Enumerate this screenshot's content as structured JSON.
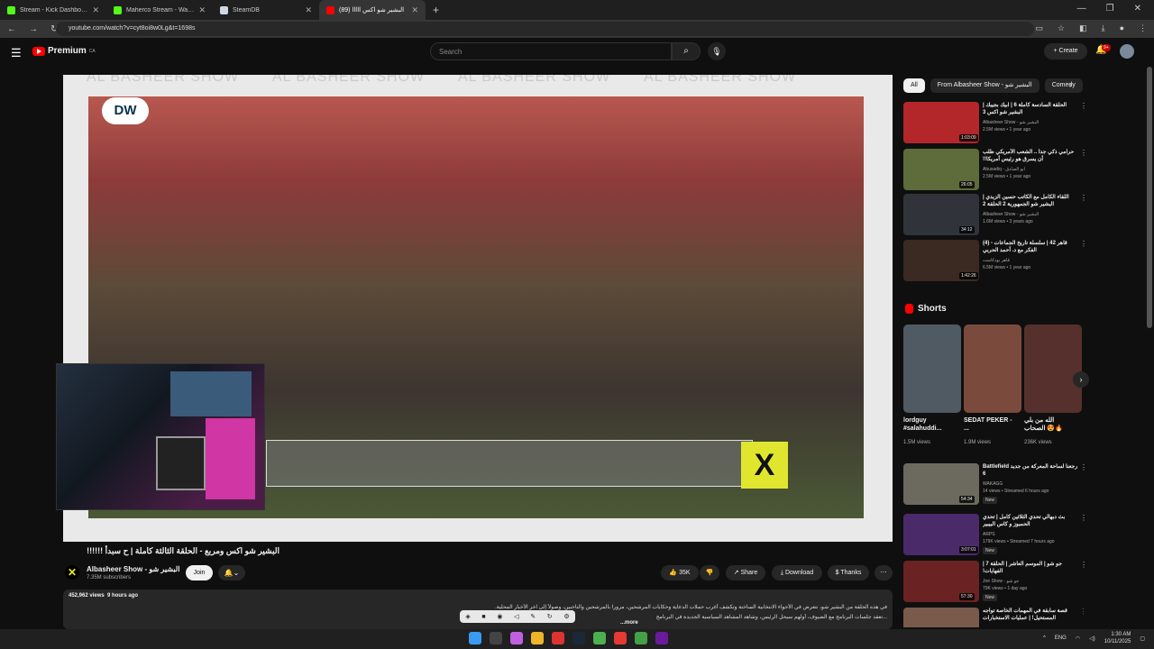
{
  "browser": {
    "tabs": [
      {
        "label": "Stream - Kick Dashboard",
        "color": "#53fc18",
        "active": false
      },
      {
        "label": "Maherco Stream - Watch Live o",
        "color": "#53fc18",
        "active": false
      },
      {
        "label": "SteamDB",
        "color": "#cfd8e0",
        "active": false
      },
      {
        "label": "(89) البشير شو اكس ااااا",
        "color": "#ff0000",
        "active": true
      }
    ],
    "new_tab": "+",
    "window_controls": [
      "—",
      "❐",
      "✕"
    ],
    "url": "youtube.com/watch?v=cyt8oi8w0Lg&t=1698s"
  },
  "youtube": {
    "logo_text": "Premium",
    "logo_region": "CA",
    "search_placeholder": "Search",
    "create_label": "Create",
    "notif_count": "9+"
  },
  "player": {
    "watermark": "AL BASHEER SHOW",
    "dw_logo": "DW",
    "channel_mark": "X"
  },
  "video": {
    "title": "البشير شو اكس ومربع - الحلقة الثالثة كاملة | ح سبدأ !!!!!!",
    "channel_name": "Albasheer Show - البشير شو",
    "subscribers": "7.35M subscribers",
    "join_label": "Join",
    "likes": "35K",
    "share_label": "Share",
    "download_label": "Download",
    "thanks_label": "Thanks",
    "views": "452,962 views",
    "age": "9 hours ago",
    "desc_line1": "في هذه الحلقة من البشير شو، نتعرض في الأجواء الانتخابية الساخنة وتكشف أغرب حملات الدعاية وحكايات المرشحين، مروراً بالمرشحين والناخبين، وصولاً إلى آخر الأخبار المحلية.",
    "desc_line2": "...تعقد جلسات البرنامج مع الضيوف، أولهم سيحل الرئيس، وشاهد المشاهد السياسية الجديدة في البرنامج",
    "more_label": "...more"
  },
  "sidebar": {
    "chips": [
      "All",
      "From Albasheer Show - البشير شو",
      "Comedy"
    ],
    "recs": [
      {
        "title": "الحلقة السادسة كاملة 6 | ابيك بجيبك | البشير شو اكس 3",
        "channel": "Albasheer Show - البشير شو",
        "views": "2.5M views • 1 year ago",
        "duration": "1:03:09",
        "color": "#b3262a"
      },
      {
        "title": "حرامي ذكي جداً .. الشعب الأمريكي طلب أن يسرق هو رئيس أمريكا!!",
        "channel": "Abusadiq - ابو الصادق",
        "views": "2.5M views • 1 year ago",
        "duration": "26:05",
        "color": "#5e6b3a"
      },
      {
        "title": "اللقاء الكامل مع الكاتب حسين الزيدي | البشير شو الجمهورية 2 الحلقة 2",
        "channel": "Albasheer Show - البشير شو",
        "views": "1.6M views • 3 years ago",
        "duration": "34:12",
        "color": "#30343a"
      },
      {
        "title": "قاهر 42 | سلسلة تاريخ الجماعات - (4) الفكر مع د. أحمد الحربي",
        "channel": "قاهر بودكاست",
        "views": "6.5M views • 1 year ago",
        "duration": "1:42:26",
        "color": "#3a2a22"
      }
    ],
    "shorts_heading": "Shorts",
    "shorts": [
      {
        "title": "lordguy #salahuddi...",
        "views": "1.5M views",
        "color": "#4f5a63"
      },
      {
        "title": "SEDAT PEKER - ...",
        "views": "1.9M views",
        "color": "#7a4a3c"
      },
      {
        "title": "الله من بلي الصحاب 😍🔥",
        "views": "236K views",
        "color": "#55302c"
      }
    ],
    "recs2": [
      {
        "title": "رجعنا لساحة المعركة من جديد Battlefield 6",
        "channel": "WAKAGG",
        "views": "14 views • Streamed 6 hours ago",
        "duration": "54:34",
        "badge": "New",
        "color": "#6c6a5e"
      },
      {
        "title": "بث دبهالي تحدي الثلاثين كامل | تحدي الحمبوز و كاس البيبير",
        "channel": "ARPS",
        "views": "179K views • Streamed 7 hours ago",
        "duration": "3:07:01",
        "badge": "New",
        "color": "#4b2a6a"
      },
      {
        "title": "جو شو | الموسم العاشر | الحلقة 7 | الفهايات!",
        "channel": "Joe Show - جو شو",
        "views": "79K views • 1 day ago",
        "duration": "57:30",
        "badge": "New",
        "color": "#6b2222"
      },
      {
        "title": "قصة سابقة في المهمات الخاصة تواجه المستحيل! | عمليات الاستخبارات",
        "channel": "",
        "views": "",
        "duration": "",
        "badge": "",
        "color": "#7a5a4a"
      }
    ]
  },
  "taskbar": {
    "lang": "ENG",
    "time": "1:30 AM",
    "date": "10/11/2025"
  }
}
